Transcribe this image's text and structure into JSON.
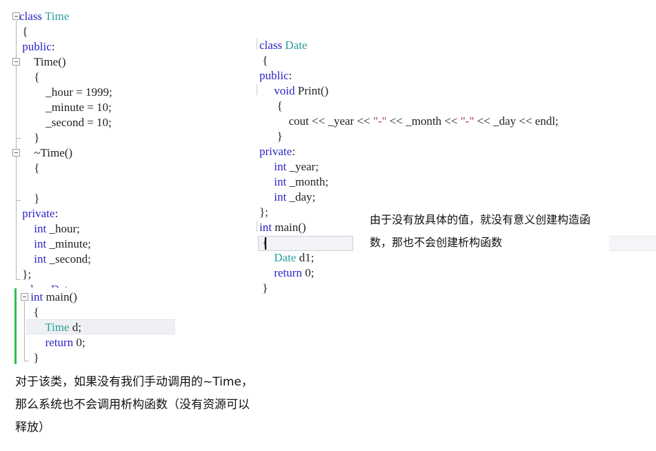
{
  "editor": {
    "colors": {
      "background": "#ffffff",
      "keyword": "#2b24c8",
      "user_type": "#2b9e9e",
      "string_literal": "#a33b3b",
      "plain_text": "#222222",
      "current_line_highlight": "#eef0f4",
      "change_bar": "#2fbf4f",
      "fold_guide": "#b6b6b6"
    }
  },
  "left_panel": {
    "name": "time-class-code-block",
    "lines": [
      {
        "indent": 0,
        "tokens": [
          {
            "t": "class",
            "c": "kw"
          },
          {
            "t": " ",
            "c": "plain"
          },
          {
            "t": "Time",
            "c": "type"
          }
        ]
      },
      {
        "indent": 0,
        "tokens": [
          {
            "t": " {",
            "c": "plain"
          }
        ]
      },
      {
        "indent": 0,
        "tokens": [
          {
            "t": " ",
            "c": "plain"
          },
          {
            "t": "public",
            "c": "kw"
          },
          {
            "t": ":",
            "c": "plain"
          }
        ]
      },
      {
        "indent": 0,
        "tokens": [
          {
            "t": "     ",
            "c": "plain"
          },
          {
            "t": "Time",
            "c": "plain"
          },
          {
            "t": "()",
            "c": "plain"
          }
        ]
      },
      {
        "indent": 0,
        "tokens": [
          {
            "t": "     {",
            "c": "plain"
          }
        ]
      },
      {
        "indent": 0,
        "tokens": [
          {
            "t": "         _hour = 1999;",
            "c": "plain"
          }
        ]
      },
      {
        "indent": 0,
        "tokens": [
          {
            "t": "         _minute = 10;",
            "c": "plain"
          }
        ]
      },
      {
        "indent": 0,
        "tokens": [
          {
            "t": "         _second = 10;",
            "c": "plain"
          }
        ]
      },
      {
        "indent": 0,
        "tokens": [
          {
            "t": "     }",
            "c": "plain"
          }
        ]
      },
      {
        "indent": 0,
        "tokens": [
          {
            "t": "     ~Time()",
            "c": "plain"
          }
        ]
      },
      {
        "indent": 0,
        "tokens": [
          {
            "t": "     {",
            "c": "plain"
          }
        ]
      },
      {
        "indent": 0,
        "tokens": [
          {
            "t": "",
            "c": "plain"
          }
        ]
      },
      {
        "indent": 0,
        "tokens": [
          {
            "t": "     }",
            "c": "plain"
          }
        ]
      },
      {
        "indent": 0,
        "tokens": [
          {
            "t": " ",
            "c": "plain"
          },
          {
            "t": "private",
            "c": "kw"
          },
          {
            "t": ":",
            "c": "plain"
          }
        ]
      },
      {
        "indent": 0,
        "tokens": [
          {
            "t": "     ",
            "c": "plain"
          },
          {
            "t": "int",
            "c": "kw"
          },
          {
            "t": " _hour;",
            "c": "plain"
          }
        ]
      },
      {
        "indent": 0,
        "tokens": [
          {
            "t": "     ",
            "c": "plain"
          },
          {
            "t": "int",
            "c": "kw"
          },
          {
            "t": " _minute;",
            "c": "plain"
          }
        ]
      },
      {
        "indent": 0,
        "tokens": [
          {
            "t": "     ",
            "c": "plain"
          },
          {
            "t": "int",
            "c": "kw"
          },
          {
            "t": " _second;",
            "c": "plain"
          }
        ]
      },
      {
        "indent": 0,
        "tokens": [
          {
            "t": " };",
            "c": "plain"
          }
        ]
      }
    ],
    "ghost_line": "  class Date",
    "main_block": {
      "lines": [
        {
          "tokens": [
            {
              "t": " ",
              "c": "plain"
            },
            {
              "t": "int",
              "c": "kw"
            },
            {
              "t": " main()",
              "c": "plain"
            }
          ]
        },
        {
          "tokens": [
            {
              "t": "  {",
              "c": "plain"
            }
          ]
        },
        {
          "tokens": [
            {
              "t": "      ",
              "c": "plain"
            },
            {
              "t": "Time",
              "c": "type"
            },
            {
              "t": " d;",
              "c": "plain"
            }
          ]
        },
        {
          "tokens": [
            {
              "t": "      ",
              "c": "plain"
            },
            {
              "t": "return",
              "c": "kw"
            },
            {
              "t": " 0;",
              "c": "plain"
            }
          ]
        },
        {
          "tokens": [
            {
              "t": "  }",
              "c": "plain"
            }
          ]
        }
      ],
      "highlighted_line_index": 2
    }
  },
  "right_panel": {
    "name": "date-class-code-block",
    "lines": [
      {
        "tokens": [
          {
            "t": "class",
            "c": "kw"
          },
          {
            "t": " ",
            "c": "plain"
          },
          {
            "t": "Date",
            "c": "type"
          }
        ]
      },
      {
        "tokens": [
          {
            "t": " {",
            "c": "plain"
          }
        ]
      },
      {
        "tokens": [
          {
            "t": "public",
            "c": "kw"
          },
          {
            "t": ":",
            "c": "plain"
          }
        ]
      },
      {
        "tokens": [
          {
            "t": "     ",
            "c": "plain"
          },
          {
            "t": "void",
            "c": "kw"
          },
          {
            "t": " Print()",
            "c": "plain"
          }
        ]
      },
      {
        "tokens": [
          {
            "t": "      {",
            "c": "plain"
          }
        ]
      },
      {
        "tokens": [
          {
            "t": "          cout << _year << ",
            "c": "plain"
          },
          {
            "t": "\"-\"",
            "c": "str"
          },
          {
            "t": " << _month << ",
            "c": "plain"
          },
          {
            "t": "\"-\"",
            "c": "str"
          },
          {
            "t": " << _day << endl;",
            "c": "plain"
          }
        ]
      },
      {
        "tokens": [
          {
            "t": "      }",
            "c": "plain"
          }
        ]
      },
      {
        "tokens": [
          {
            "t": "private",
            "c": "kw"
          },
          {
            "t": ":",
            "c": "plain"
          }
        ]
      },
      {
        "tokens": [
          {
            "t": "     ",
            "c": "plain"
          },
          {
            "t": "int",
            "c": "kw"
          },
          {
            "t": " _year;",
            "c": "plain"
          }
        ]
      },
      {
        "tokens": [
          {
            "t": "     ",
            "c": "plain"
          },
          {
            "t": "int",
            "c": "kw"
          },
          {
            "t": " _month;",
            "c": "plain"
          }
        ]
      },
      {
        "tokens": [
          {
            "t": "     ",
            "c": "plain"
          },
          {
            "t": "int",
            "c": "kw"
          },
          {
            "t": " _day;",
            "c": "plain"
          }
        ]
      },
      {
        "tokens": [
          {
            "t": "};",
            "c": "plain"
          }
        ]
      },
      {
        "tokens": [
          {
            "t": "int",
            "c": "kw"
          },
          {
            "t": " main()",
            "c": "plain"
          }
        ]
      },
      {
        "tokens": [
          {
            "t": " {",
            "c": "plain"
          }
        ]
      },
      {
        "tokens": [
          {
            "t": "     ",
            "c": "plain"
          },
          {
            "t": "Date",
            "c": "type"
          },
          {
            "t": " d1;",
            "c": "plain"
          }
        ]
      },
      {
        "tokens": [
          {
            "t": "     ",
            "c": "plain"
          },
          {
            "t": "return",
            "c": "kw"
          },
          {
            "t": " 0;",
            "c": "plain"
          }
        ]
      },
      {
        "tokens": [
          {
            "t": " }",
            "c": "plain"
          }
        ]
      }
    ],
    "highlighted_line_index": 13
  },
  "annotations": {
    "right_note": {
      "line1": "由于没有放具体的值，就没有意义创建构造函",
      "line2": "数，那也不会创建析构函数"
    },
    "bottom_note": {
      "line1": "对于该类，如果没有我们手动调用的~Time，",
      "line2": "那么系统也不会调用析构函数（没有资源可以",
      "line3": "释放）"
    }
  }
}
